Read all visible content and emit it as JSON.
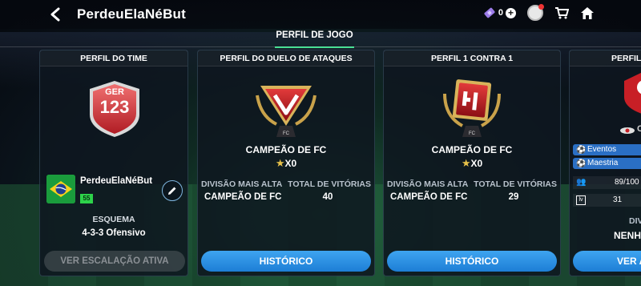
{
  "header": {
    "title": "PerdeuElaNéBut",
    "coins": "0"
  },
  "section_tab": "PERFIL DE JOGO",
  "team_card": {
    "header": "PERFIL DO TIME",
    "rating_label": "GER",
    "rating_value": "123",
    "player_name": "PerdeuElaNéBut",
    "level": "55",
    "scheme_label": "ESQUEMA",
    "scheme_value": "4-3-3 Ofensivo",
    "button": "VER ESCALAÇÃO ATIVA"
  },
  "attack_duel_card": {
    "header": "PERFIL DO DUELO DE ATAQUES",
    "champion": "CAMPEÃO DE FC",
    "stars": "X0",
    "highest_division_label": "DIVISÃO MAIS ALTA",
    "total_wins_label": "TOTAL DE VITÓRIAS",
    "highest_division": "CAMPEÃO DE FC",
    "total_wins": "40",
    "button": "HISTÓRICO"
  },
  "one_v_one_card": {
    "header": "PERFIL 1 CONTRA 1",
    "champion": "CAMPEÃO DE FC",
    "stars": "X0",
    "highest_division_label": "DIVISÃO MAIS ALTA",
    "total_wins_label": "TOTAL DE VITÓRIAS",
    "highest_division": "CAMPEÃO DE FC",
    "total_wins": "29",
    "button": "HISTÓRICO"
  },
  "partial_card": {
    "header": "PERFIL",
    "club_initial": "C",
    "pill1": "Eventos",
    "pill2": "Maestria",
    "members": "89/100",
    "level": "31",
    "division": "DIV",
    "division_value": "NENH",
    "button": "VER A"
  },
  "colors": {
    "accent_green": "#3adf8c",
    "button_blue": "#2e90e4",
    "badge_red": "#c8252c",
    "level_green": "#2dd24a"
  }
}
